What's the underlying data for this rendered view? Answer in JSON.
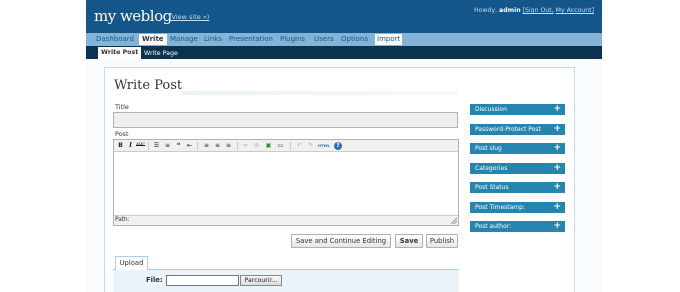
{
  "header": {
    "blog_title": "my weblog",
    "view_site": "(View site »)",
    "howdy": "Howdy,",
    "username": "admin",
    "sign_out": "[Sign Out,",
    "my_account": "My Account]"
  },
  "main_nav": [
    "Dashboard",
    "Write",
    "Manage",
    "Links",
    "Presentation",
    "Plugins",
    "Users",
    "Options",
    "Import"
  ],
  "main_nav_active": "Write",
  "sub_nav": [
    "Write Post",
    "Write Page"
  ],
  "sub_nav_active": "Write Post",
  "page": {
    "title": "Write Post",
    "title_label": "Title",
    "title_value": "",
    "post_label": "Post",
    "path_label": "Path:"
  },
  "toolbar_icons": [
    "bold-icon",
    "italic-icon",
    "strikethrough-icon",
    "bullet-list-icon",
    "numbered-list-icon",
    "blockquote-icon",
    "align-left-icon",
    "align-center-icon",
    "align-right-icon",
    "link-icon",
    "unlink-icon",
    "insert-image-icon",
    "more-tag-icon",
    "undo-icon",
    "redo-icon",
    "html-icon",
    "help-icon"
  ],
  "toolbar_text": {
    "bold": "B",
    "italic": "I",
    "strike": "ABC",
    "html": "HTML",
    "help": "?"
  },
  "buttons": {
    "save_continue": "Save and Continue Editing",
    "save": "Save",
    "publish": "Publish"
  },
  "upload": {
    "tab": "Upload",
    "file_label": "File:",
    "browse": "Parcourir..."
  },
  "sidebar": {
    "plus": "+",
    "items": [
      "Discussion",
      "Password-Protect Post",
      "Post slug",
      "Categories",
      "Post Status",
      "Post Timestamp:",
      "Post author:"
    ]
  },
  "colors": {
    "header_bg": "#14568a",
    "nav_bg": "#83b4d8",
    "subnav_bg": "#0d324f",
    "sidebar_box": "#2685af"
  }
}
